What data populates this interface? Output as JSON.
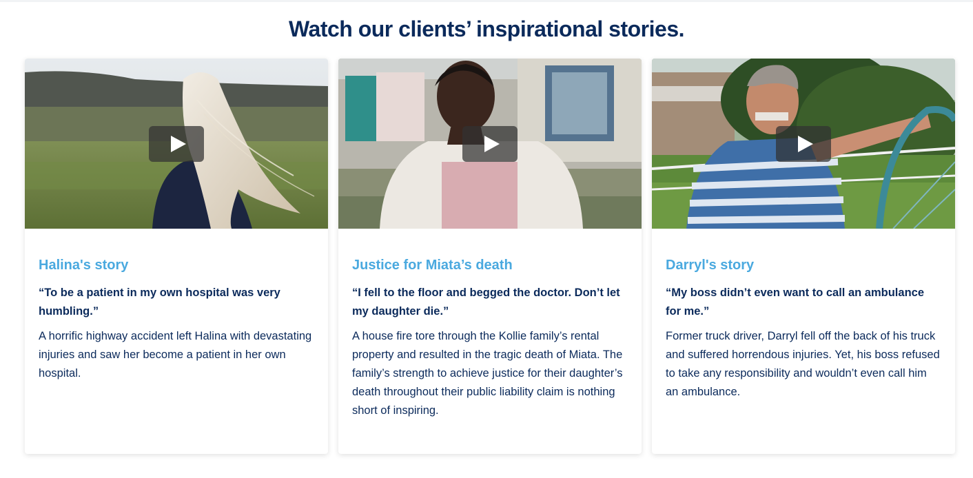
{
  "section": {
    "title": "Watch our clients’ inspirational stories."
  },
  "cards": [
    {
      "title": "Halina's story",
      "quote": "“To be a patient in my own hospital was very humbling.”",
      "description": "A horrific highway accident left Halina with devastating injuries and saw her become a patient in her own hospital."
    },
    {
      "title": "Justice for Miata’s death",
      "quote": "“I fell to the floor and begged the doctor. Don’t let my daughter die.”",
      "description": "A house fire tore through the Kollie family’s rental property and resulted in the tragic death of Miata. The family’s strength to achieve justice for their daughter’s death throughout their public liability claim is nothing short of inspiring."
    },
    {
      "title": "Darryl's story",
      "quote": "“My boss didn’t even want to call an ambulance for me.”",
      "description": "Former truck driver, Darryl fell off the back of his truck and suffered horrendous injuries. Yet, his boss refused to take any responsibility and wouldn’t even call him an ambulance."
    }
  ],
  "icons": {
    "play": "play-icon"
  },
  "colors": {
    "heading": "#0b2a5b",
    "card_title": "#4aa9df",
    "text": "#0b2a5b",
    "play_overlay": "rgba(50,50,50,0.72)"
  }
}
